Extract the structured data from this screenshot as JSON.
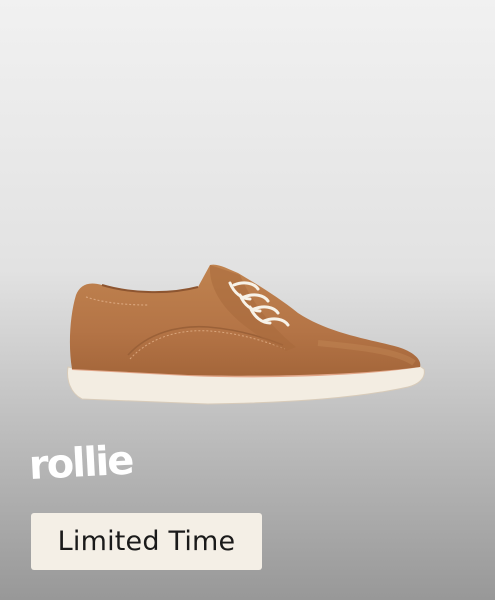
{
  "product": {
    "image_icon": "brown-leather-derby-shoe-icon",
    "upper_color": "#b87a4a",
    "sole_color": "#f3ede2"
  },
  "brand": {
    "logo_text": "rollie"
  },
  "promo": {
    "badge_label": "Limited Time"
  }
}
